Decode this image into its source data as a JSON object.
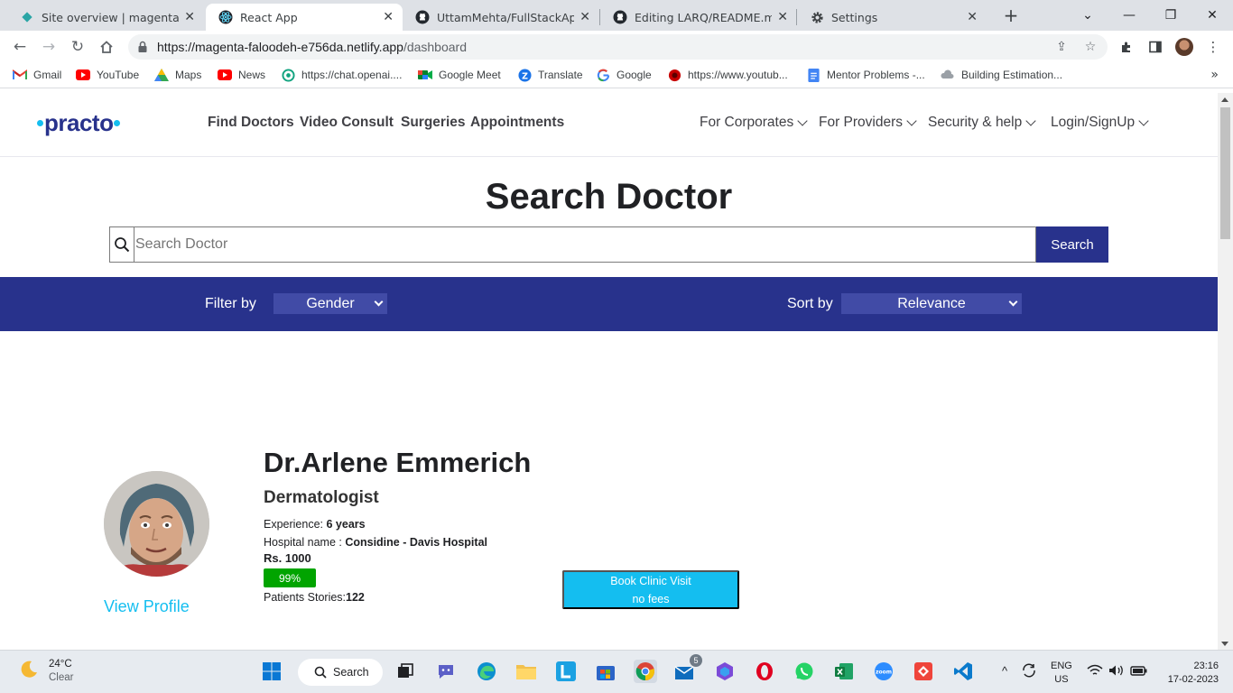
{
  "browser": {
    "tabs": [
      {
        "title": "Site overview | magenta-faloo",
        "active": false
      },
      {
        "title": "React App",
        "active": true
      },
      {
        "title": "UttamMehta/FullStackApplic",
        "active": false
      },
      {
        "title": "Editing LARQ/README.md at",
        "active": false
      },
      {
        "title": "Settings",
        "active": false
      }
    ],
    "url_host": "https://magenta-faloodeh-e756da.netlify.app",
    "url_path": "/dashboard",
    "bookmarks": [
      {
        "label": "Gmail",
        "icon": "gmail-icon"
      },
      {
        "label": "YouTube",
        "icon": "youtube-icon"
      },
      {
        "label": "Maps",
        "icon": "maps-icon"
      },
      {
        "label": "News",
        "icon": "news-icon"
      },
      {
        "label": "https://chat.openai....",
        "icon": "openai-icon"
      },
      {
        "label": "Google Meet",
        "icon": "meet-icon"
      },
      {
        "label": "Translate",
        "icon": "translate-icon"
      },
      {
        "label": "Google",
        "icon": "google-icon"
      },
      {
        "label": "https://www.youtub...",
        "icon": "opera-icon"
      },
      {
        "label": "Mentor Problems -...",
        "icon": "docs-icon"
      },
      {
        "label": "Building Estimation...",
        "icon": "cloud-icon"
      }
    ]
  },
  "site": {
    "logo_word": "practo",
    "nav_links": [
      "Find Doctors",
      "Video Consult",
      "Surgeries",
      "Appointments"
    ],
    "nav_right": [
      "For Corporates",
      "For Providers",
      "Security & help",
      "Login/SignUp"
    ],
    "page_title": "Search Doctor",
    "search": {
      "placeholder": "Search Doctor",
      "button_label": "Search"
    },
    "filter": {
      "filter_label": "Filter by",
      "filter_value": "Gender",
      "sort_label": "Sort by",
      "sort_value": "Relevance"
    },
    "doctor": {
      "name": "Dr.Arlene Emmerich",
      "specialty": "Dermatologist",
      "experience_label": "Experience: ",
      "experience_value": "6 years",
      "hospital_label": "Hospital name : ",
      "hospital_value": "Considine - Davis Hospital",
      "fee": "Rs. 1000",
      "rating": "99%",
      "stories_label": "Patients Stories:",
      "stories_value": "122",
      "view_profile": "View Profile",
      "book_line1": "Book Clinic Visit",
      "book_line2": "no fees"
    }
  },
  "taskbar": {
    "weather_temp": "24°C",
    "weather_desc": "Clear",
    "search_label": "Search",
    "mail_badge": "5",
    "lang_top": "ENG",
    "lang_bottom": "US",
    "time": "23:16",
    "date": "17-02-2023"
  },
  "colors": {
    "brand_navy": "#28328c",
    "brand_cyan": "#14bef0",
    "rating_green": "#01a400"
  }
}
